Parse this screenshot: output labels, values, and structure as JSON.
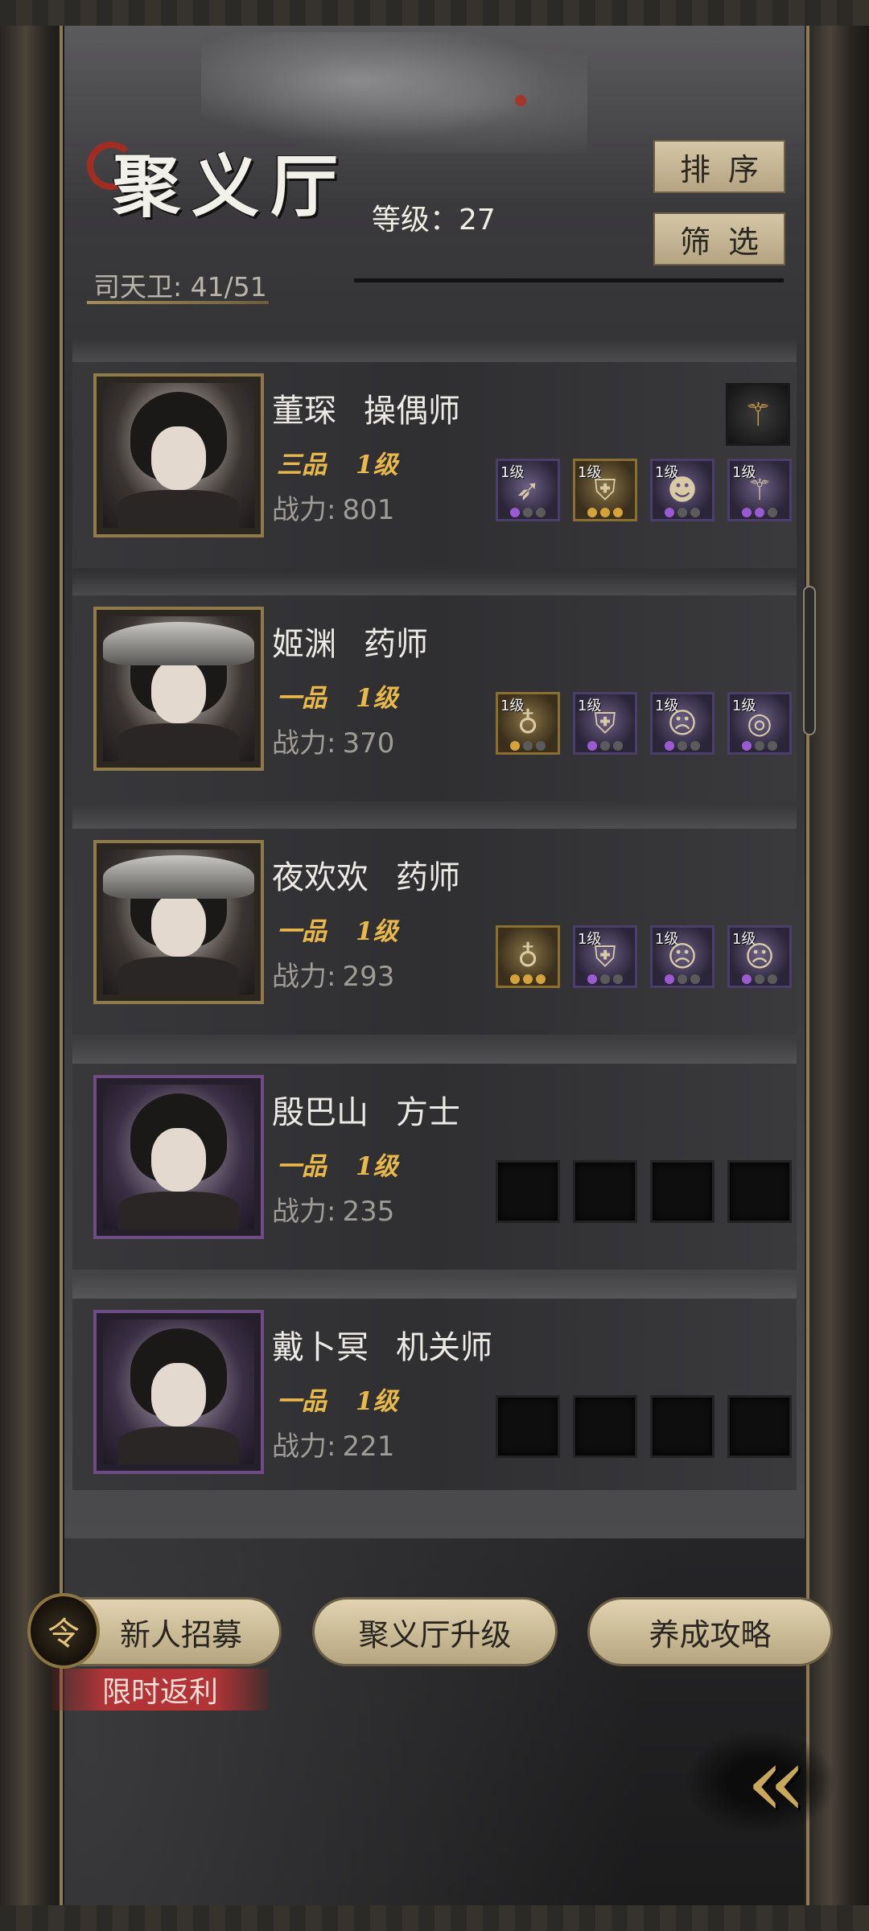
{
  "header": {
    "title": "聚义厅",
    "level_label": "等级：",
    "level_value": "27",
    "guard_label": "司天卫: ",
    "guard_count": "41/51",
    "sort_label": "排序",
    "filter_label": "筛选"
  },
  "characters": [
    {
      "name": "董琛",
      "role": "操偶师",
      "grade": "三品",
      "level": "1级",
      "power_label": "战力:",
      "power": "801",
      "frame": "gold",
      "special_item_icon": "staff-icon",
      "gear": [
        {
          "level": "1级",
          "icon": "crossbow-icon",
          "tier": "purple",
          "stars": 1
        },
        {
          "level": "1级",
          "icon": "armor-icon",
          "tier": "gold",
          "stars": 3
        },
        {
          "level": "1级",
          "icon": "mask-icon",
          "tier": "purple",
          "stars": 1
        },
        {
          "level": "1级",
          "icon": "staff-icon",
          "tier": "purple",
          "stars": 2
        }
      ]
    },
    {
      "name": "姬渊",
      "role": "药师",
      "grade": "一品",
      "level": "1级",
      "power_label": "战力:",
      "power": "370",
      "frame": "gold",
      "gear": [
        {
          "level": "1级",
          "icon": "gourd-icon",
          "tier": "gold",
          "stars": 1
        },
        {
          "level": "1级",
          "icon": "robe-icon",
          "tier": "purple",
          "stars": 1
        },
        {
          "level": "1级",
          "icon": "demon-mask-icon",
          "tier": "purple",
          "stars": 1
        },
        {
          "level": "1级",
          "icon": "jade-disc-icon",
          "tier": "purple",
          "stars": 1
        }
      ]
    },
    {
      "name": "夜欢欢",
      "role": "药师",
      "grade": "一品",
      "level": "1级",
      "power_label": "战力:",
      "power": "293",
      "frame": "gold",
      "gear": [
        {
          "level": "",
          "icon": "gourd-icon",
          "tier": "gold",
          "stars": 3
        },
        {
          "level": "1级",
          "icon": "robe-icon",
          "tier": "purple",
          "stars": 1
        },
        {
          "level": "1级",
          "icon": "demon-mask-icon",
          "tier": "purple",
          "stars": 1
        },
        {
          "level": "1级",
          "icon": "demon-mask-icon",
          "tier": "purple",
          "stars": 1
        }
      ]
    },
    {
      "name": "殷巴山",
      "role": "方士",
      "grade": "一品",
      "level": "1级",
      "power_label": "战力:",
      "power": "235",
      "frame": "purple",
      "gear": []
    },
    {
      "name": "戴卜冥",
      "role": "机关师",
      "grade": "一品",
      "level": "1级",
      "power_label": "战力:",
      "power": "221",
      "frame": "purple",
      "gear": []
    }
  ],
  "footer": {
    "recruit_label": "新人招募",
    "recruit_icon": "recruit-token-icon",
    "limited_label": "限时返利",
    "upgrade_label": "聚义厅升级",
    "guide_label": "养成攻略",
    "back_icon": "double-chevron-left-icon"
  },
  "colors": {
    "gold_text": "#e9b84a",
    "button_bg": "#d5c7a6",
    "limited_red": "#b23436",
    "purple_frame": "#6e4d86",
    "gold_frame": "#8f7a4c"
  }
}
